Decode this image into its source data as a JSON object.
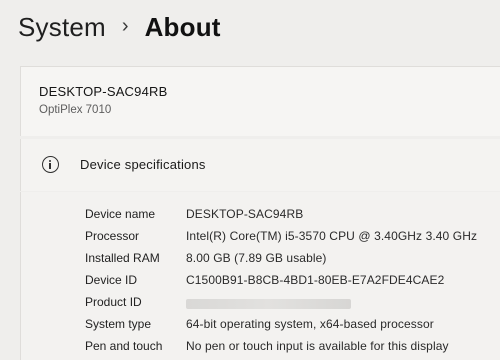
{
  "breadcrumb": {
    "parent": "System",
    "separator": "›",
    "current": "About"
  },
  "device": {
    "name": "DESKTOP-SAC94RB",
    "model": "OptiPlex 7010"
  },
  "device_specifications": {
    "title": "Device specifications",
    "icon": "info-icon",
    "rows": [
      {
        "label": "Device name",
        "value": "DESKTOP-SAC94RB"
      },
      {
        "label": "Processor",
        "value": "Intel(R) Core(TM) i5-3570 CPU @ 3.40GHz   3.40 GHz"
      },
      {
        "label": "Installed RAM",
        "value": "8.00 GB (7.89 GB usable)"
      },
      {
        "label": "Device ID",
        "value": "C1500B91-B8CB-4BD1-80EB-E7A2FDE4CAE2"
      },
      {
        "label": "Product ID",
        "value": ""
      },
      {
        "label": "System type",
        "value": "64-bit operating system, x64-based processor"
      },
      {
        "label": "Pen and touch",
        "value": "No pen or touch input is available for this display"
      }
    ]
  },
  "colors": {
    "page_background": "#efeeec",
    "card_background": "#f6f5f3",
    "text_primary": "#1b1b1b",
    "text_secondary": "#5d5d5d"
  }
}
